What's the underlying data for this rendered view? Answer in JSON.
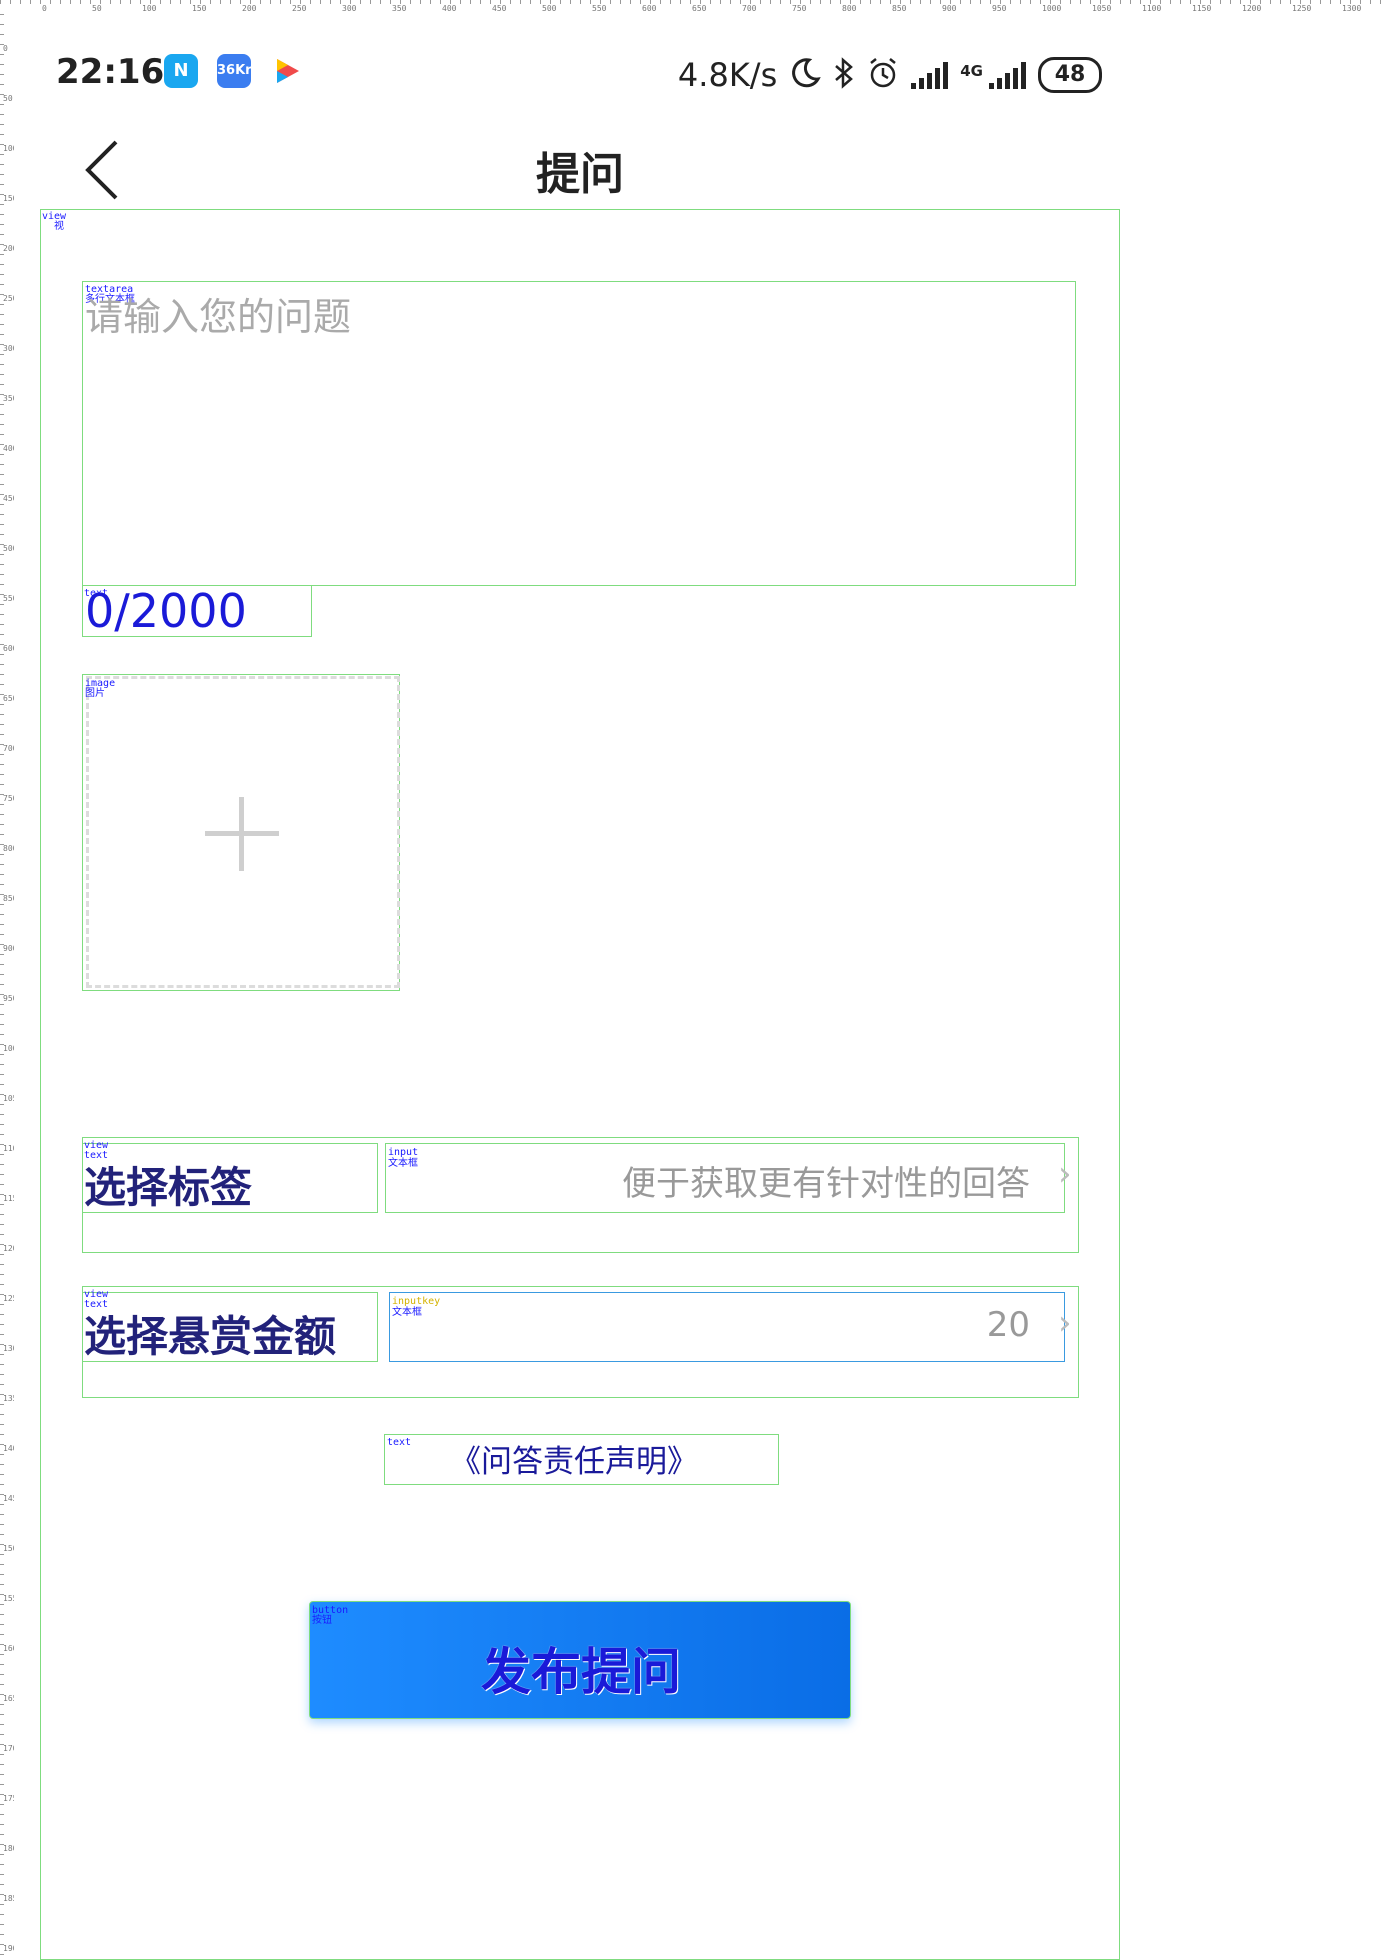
{
  "ruler": {
    "top_ticks": [
      "0",
      "50",
      "100",
      "150",
      "200",
      "250",
      "300",
      "350",
      "400",
      "450",
      "500",
      "550",
      "600",
      "650",
      "700",
      "750",
      "800",
      "850",
      "900",
      "950",
      "1000",
      "1050",
      "1100",
      "1150",
      "1200",
      "1250",
      "1300"
    ],
    "left_ticks": [
      "0",
      "50",
      "100",
      "150",
      "200",
      "250",
      "300",
      "350",
      "400",
      "450",
      "500",
      "550",
      "600",
      "650",
      "700",
      "750",
      "800",
      "850",
      "900",
      "950",
      "1000",
      "1050",
      "1100",
      "1150",
      "1200",
      "1250",
      "1300",
      "1350",
      "1400",
      "1450",
      "1500",
      "1550",
      "1600",
      "1650",
      "1700",
      "1750",
      "1800",
      "1850",
      "1900"
    ]
  },
  "status_bar": {
    "time": "22:16",
    "apps": [
      {
        "icon": "n-app-icon",
        "label": "N",
        "color": "#1aa7f0"
      },
      {
        "icon": "36kr-icon",
        "label": "36Kr",
        "color": "#3b7df0"
      },
      {
        "icon": "play-app-icon",
        "label": "",
        "color": "#f04a4a"
      }
    ],
    "net_speed": "4.8K/s",
    "network_type": "4G",
    "battery": "48"
  },
  "header": {
    "title": "提问",
    "back_icon": "chevron-left-icon"
  },
  "debug": {
    "view_tag": "view",
    "view_sub": "视",
    "textarea_tag": "textarea",
    "textarea_sub": "多行文本框",
    "text_tag": "text",
    "image_tag": "image",
    "image_sub": "图片",
    "input_tag": "input",
    "input_sub": "文本框",
    "inputkey_tag": "inputkey",
    "button_tag": "button",
    "button_sub": "按钮"
  },
  "question": {
    "placeholder": "请输入您的问题",
    "counter": "0/2000"
  },
  "upload": {
    "icon": "plus-icon"
  },
  "tag_row": {
    "label": "选择标签",
    "placeholder": "便于获取更有针对性的回答",
    "chevron": "›"
  },
  "reward_row": {
    "label": "选择悬赏金额",
    "value": "20",
    "chevron": "›"
  },
  "disclaimer": "《问答责任声明》",
  "publish_button": "发布提问"
}
